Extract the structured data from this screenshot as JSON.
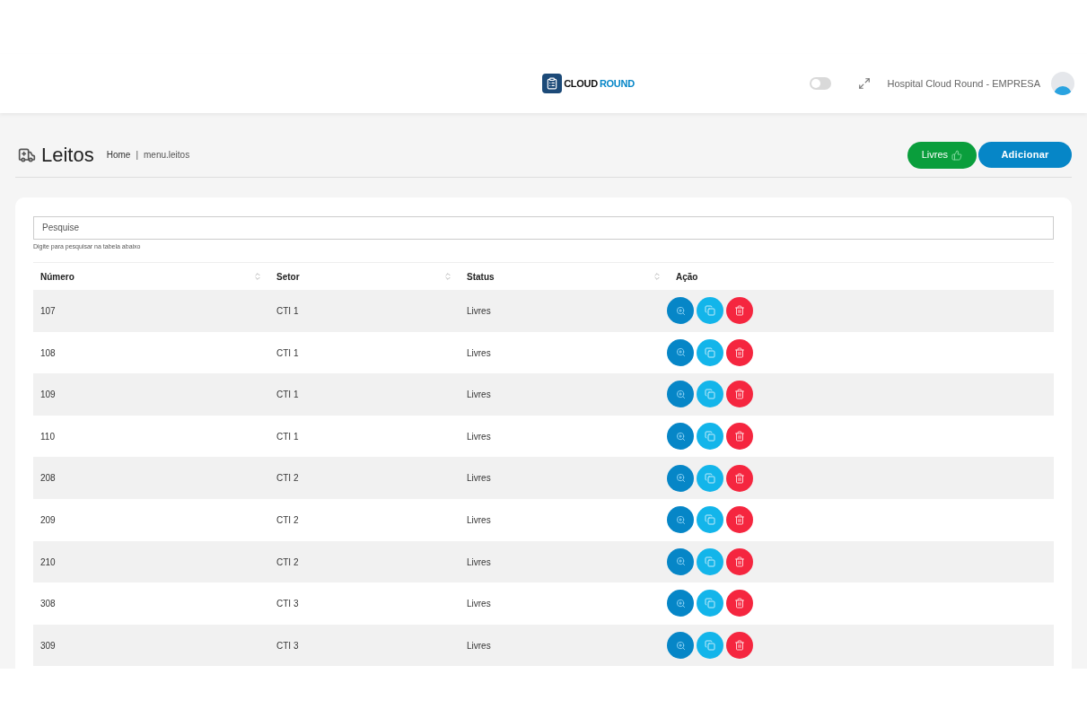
{
  "header": {
    "logo": {
      "part1": "CLOUD",
      "part2": "ROUND"
    },
    "theme_toggle": {
      "on": false
    },
    "user": "Hospital Cloud Round - EMPRESA"
  },
  "page": {
    "title": "Leitos",
    "breadcrumb": [
      "Home",
      "menu.leitos"
    ],
    "breadcrumb_separator": "|",
    "buttons": [
      {
        "label": "Livres",
        "kind": "filter"
      },
      {
        "label": "Adicionar",
        "kind": "add"
      }
    ]
  },
  "search": {
    "placeholder": "Pesquise",
    "hint": "Digite para pesquisar na tabela abaixo"
  },
  "table": {
    "columns": [
      {
        "label": "Número",
        "sortable": true
      },
      {
        "label": "Setor",
        "sortable": true
      },
      {
        "label": "Status",
        "sortable": true
      },
      {
        "label": "Ação",
        "sortable": false
      }
    ],
    "rows": [
      {
        "numero": "107",
        "setor": "CTI 1",
        "status": "Livres"
      },
      {
        "numero": "108",
        "setor": "CTI 1",
        "status": "Livres"
      },
      {
        "numero": "109",
        "setor": "CTI 1",
        "status": "Livres"
      },
      {
        "numero": "110",
        "setor": "CTI 1",
        "status": "Livres"
      },
      {
        "numero": "208",
        "setor": "CTI 2",
        "status": "Livres"
      },
      {
        "numero": "209",
        "setor": "CTI 2",
        "status": "Livres"
      },
      {
        "numero": "210",
        "setor": "CTI 2",
        "status": "Livres"
      },
      {
        "numero": "308",
        "setor": "CTI 3",
        "status": "Livres"
      },
      {
        "numero": "309",
        "setor": "CTI 3",
        "status": "Livres"
      }
    ]
  }
}
